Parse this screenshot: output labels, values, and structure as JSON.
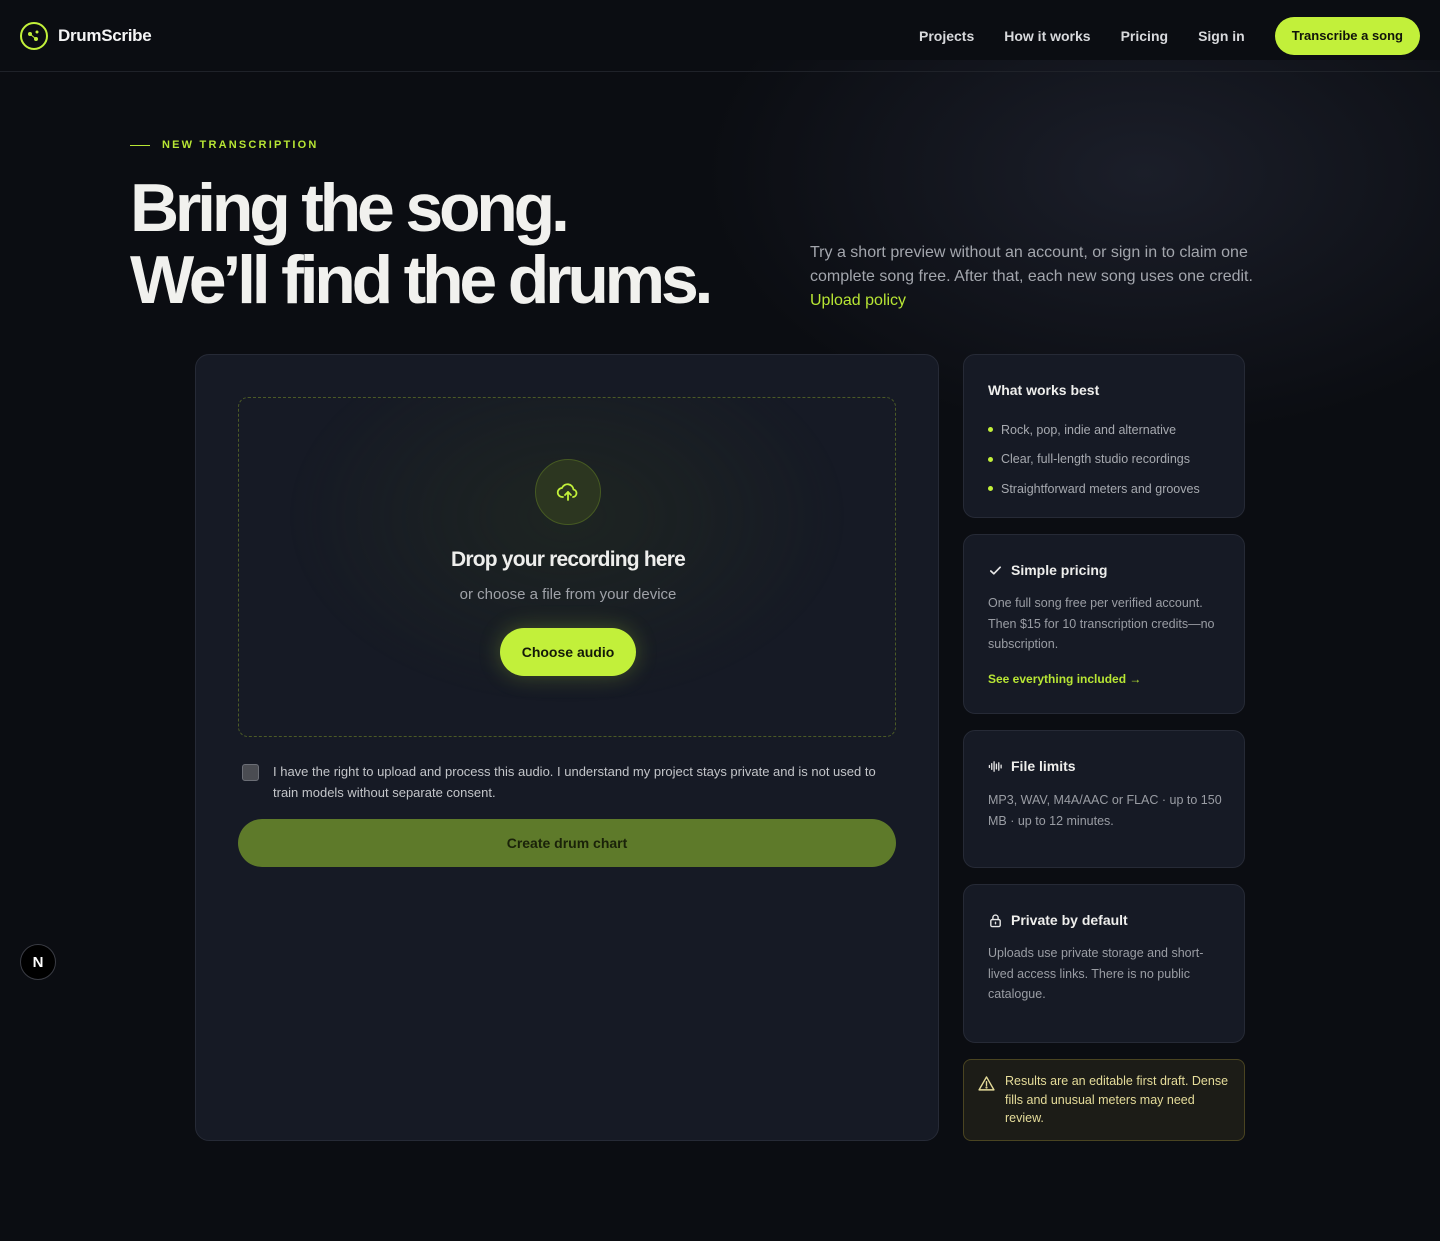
{
  "brand": {
    "name": "DrumScribe"
  },
  "nav": {
    "items": [
      "Projects",
      "How it works",
      "Pricing",
      "Sign in"
    ],
    "cta": "Transcribe a song"
  },
  "hero": {
    "eyebrow": "NEW TRANSCRIPTION",
    "headline_line1": "Bring the song.",
    "headline_line2": "We’ll find the drums.",
    "copy": "Try a short preview without an account, or sign in to claim one complete song free. After that, each new song uses one credit.",
    "link": "Upload policy"
  },
  "upload": {
    "dropzone_title": "Drop your recording here",
    "dropzone_sub": "or choose a file from your device",
    "choose_button": "Choose audio",
    "consent_text": "I have the right to upload and process this audio. I understand my project stays private and is not used to train models without separate consent.",
    "consent_checked": false,
    "create_button": "Create drum chart"
  },
  "cards": {
    "works_best": {
      "title": "What works best",
      "items": [
        "Rock, pop, indie and alternative",
        "Clear, full-length studio recordings",
        "Straightforward meters and grooves"
      ]
    },
    "pricing": {
      "title": "Simple pricing",
      "body": "One full song free per verified account. Then $15 for 10 transcription credits—no subscription.",
      "link": "See everything included →"
    },
    "limits": {
      "title": "File limits",
      "body": "MP3, WAV, M4A/AAC or FLAC · up to 150 MB · up to 12 minutes."
    },
    "privacy": {
      "title": "Private by default",
      "body": "Uploads use private storage and short-lived access links. There is no public catalogue."
    }
  },
  "notice": {
    "text": "Results are an editable first draft. Dense fills and unusual meters may need review."
  },
  "floating_badge": {
    "letter": "N"
  },
  "colors": {
    "accent": "#c2f03a",
    "background": "#0b0d12",
    "card": "#161a25",
    "notice_text": "#e5dc9a"
  }
}
